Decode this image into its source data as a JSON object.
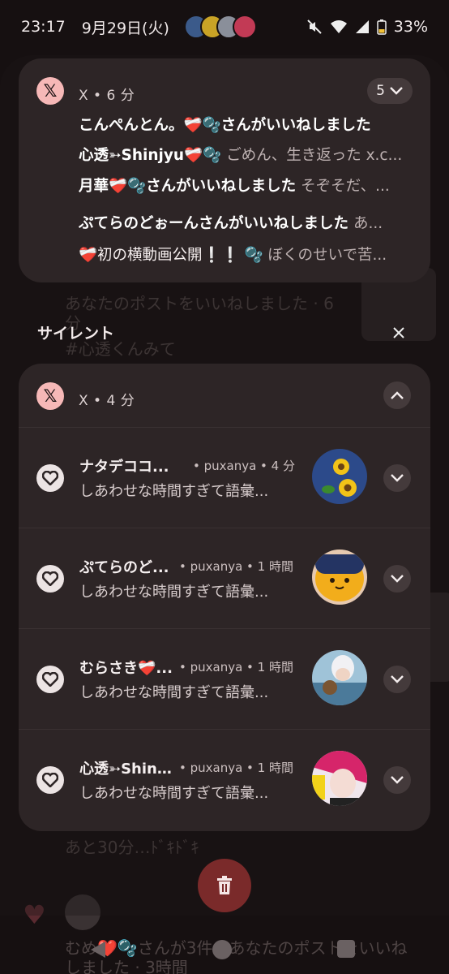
{
  "status_bar": {
    "time": "23:17",
    "date": "9月29日(火)",
    "battery": "33%",
    "icons": [
      "mute-icon",
      "wifi-icon",
      "signal-icon",
      "battery-icon"
    ]
  },
  "background": {
    "lines": [
      "あなたのポストをいいねしました · 6",
      "分",
      "#心透くんみて",
      "あと30分…ﾄﾞｷﾄﾞｷ",
      "むめ❤️🫧さんが3件のあなたのポストをいいね",
      "しました · 3時間"
    ]
  },
  "top_card": {
    "app_icon_glyph": "𝕏",
    "app_meta": "X • 6 分",
    "count": "5",
    "lines": [
      {
        "title_parts": [
          "こんぺんとん。",
          "❤️‍🩹",
          "🫧",
          "さんがいいねしました"
        ],
        "sub": ""
      },
      {
        "title_parts": [
          "心透➳Shinjyu",
          "❤️‍🩹",
          "🫧",
          ""
        ],
        "sub": "ごめん、生き返った x.c..."
      },
      {
        "title_parts": [
          "月華",
          "❤️‍🩹",
          "🫧",
          "さんがいいねしました"
        ],
        "sub": "そぞそだ、..."
      },
      {
        "title_parts": [
          "ぷてらのどぉーんさんがいいねしました",
          "",
          "",
          ""
        ],
        "sub": "あ..."
      },
      {
        "title_parts": [
          "",
          "❤️‍🩹",
          "",
          "初の横動画公開❕❕"
        ],
        "sub": "🫧 ぼくのせいで苦..."
      }
    ]
  },
  "silent": {
    "header": "サイレント",
    "app_icon_glyph": "𝕏",
    "app_meta": "X • 4 分",
    "rows": [
      {
        "title": "ナタデココ...",
        "meta": "• puxanya • 4 分",
        "text": "しあわせな時間すぎて語彙...",
        "avatar": "sunflower"
      },
      {
        "title": "ぷてらのど...",
        "meta": "• puxanya • 1 時間",
        "text": "しあわせな時間すぎて語彙...",
        "avatar": "yellow-face"
      },
      {
        "title": "むらさき❤️‍🩹...",
        "meta": "• puxanya • 1 時間",
        "text": "しあわせな時間すぎて語彙...",
        "avatar": "white-hair"
      },
      {
        "title": "心透➳Shinj...",
        "meta": "• puxanya • 1 時間",
        "text": "しあわせな時間すぎて語彙...",
        "avatar": "pink-hair"
      }
    ]
  },
  "colors": {
    "accent_pink": "#f6b8b7",
    "card": "#2d2526",
    "trash": "#7a2a2a"
  }
}
